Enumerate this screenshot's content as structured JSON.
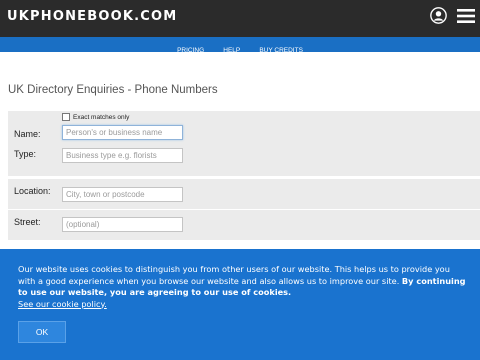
{
  "header": {
    "logo": "UKPHONEBOOK.COM",
    "icons": [
      "user-icon",
      "hamburger-menu-icon"
    ]
  },
  "nav": {
    "items": [
      "PRICING",
      "HELP",
      "BUY CREDITS"
    ]
  },
  "main": {
    "title": "UK Directory Enquiries - Phone Numbers",
    "exact_matches_label": "Exact matches only",
    "name_label": "Name:",
    "name_placeholder": "Person's or business name",
    "type_label": "Type:",
    "type_placeholder": "Business type e.g. florists",
    "location_label": "Location:",
    "location_placeholder": "City, town or postcode",
    "street_label": "Street:",
    "street_placeholder": "(optional)"
  },
  "cookie_banner": {
    "text_plain": "Our website uses cookies to distinguish you from other users of our website. This helps us to provide you with a good experience when you browse our website and also allows us to improve our site. ",
    "text_bold": "By continuing to use our website, you are agreeing to our use of cookies.",
    "policy_link": "See our cookie policy.",
    "ok_label": "OK"
  },
  "colors": {
    "topbar": "#2b2b2b",
    "navbar": "#1a6fc4",
    "cookie_banner": "#1a73cf"
  }
}
